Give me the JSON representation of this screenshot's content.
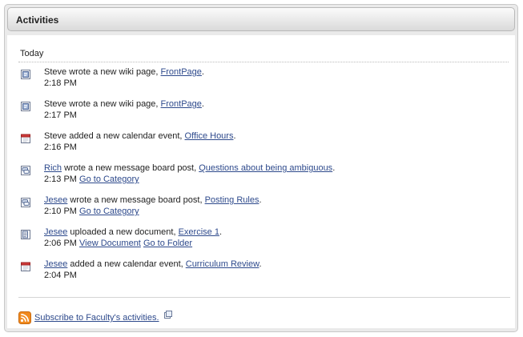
{
  "portlet": {
    "title": "Activities"
  },
  "day": {
    "label": "Today"
  },
  "activities": [
    {
      "icon": "wiki-page-icon",
      "actor": "Steve",
      "actor_link": false,
      "action": " wrote a new wiki page, ",
      "target": "FrontPage",
      "after": ".",
      "time": "2:18 PM",
      "links": []
    },
    {
      "icon": "wiki-page-icon",
      "actor": "Steve",
      "actor_link": false,
      "action": " wrote a new wiki page, ",
      "target": "FrontPage",
      "after": ".",
      "time": "2:17 PM",
      "links": []
    },
    {
      "icon": "calendar-icon",
      "actor": "Steve",
      "actor_link": false,
      "action": " added a new calendar event, ",
      "target": "Office Hours",
      "after": ".",
      "time": "2:16 PM",
      "links": []
    },
    {
      "icon": "message-board-icon",
      "actor": "Rich",
      "actor_link": true,
      "action": " wrote a new message board post, ",
      "target": "Questions about being ambiguous",
      "after": ".",
      "time": "2:13 PM",
      "links": [
        "Go to Category"
      ]
    },
    {
      "icon": "message-board-icon",
      "actor": "Jesee",
      "actor_link": true,
      "action": " wrote a new message board post, ",
      "target": "Posting Rules",
      "after": ".",
      "time": "2:10 PM",
      "links": [
        "Go to Category"
      ]
    },
    {
      "icon": "document-icon",
      "actor": "Jesee",
      "actor_link": true,
      "action": " uploaded a new document, ",
      "target": "Exercise 1",
      "after": ".",
      "time": "2:06 PM",
      "links": [
        "View Document",
        "Go to Folder"
      ]
    },
    {
      "icon": "calendar-icon",
      "actor": "Jesee",
      "actor_link": true,
      "action": " added a new calendar event, ",
      "target": "Curriculum Review",
      "after": ".",
      "time": "2:04 PM",
      "links": []
    }
  ],
  "footer": {
    "subscribe_label": "Subscribe to Faculty's activities."
  },
  "colors": {
    "link": "#2e4a8c",
    "rss": "#f0891e"
  }
}
